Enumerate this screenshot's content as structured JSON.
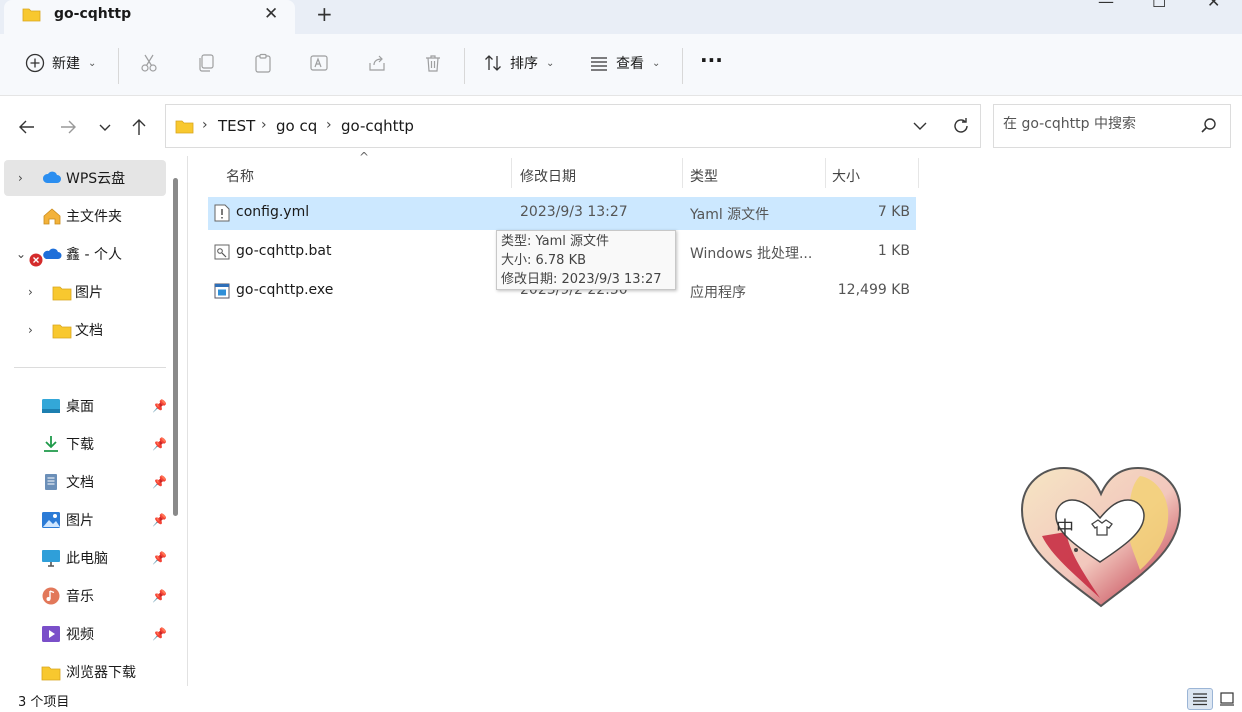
{
  "window": {
    "tab_title": "go-cqhttp",
    "tab_close": "✕",
    "new_tab": "+",
    "minimize": "—",
    "maximize": "☐",
    "close": "✕"
  },
  "toolbar": {
    "new_label": "新建",
    "sort_label": "排序",
    "view_label": "查看",
    "more_label": "···",
    "icons": [
      "add-circle-icon",
      "cut-icon",
      "copy-icon",
      "paste-icon",
      "rename-icon",
      "share-icon",
      "delete-icon",
      "sort-icon",
      "view-icon"
    ]
  },
  "address": {
    "crumbs": [
      "TEST",
      "go cq",
      "go-cqhttp"
    ],
    "separator": "›"
  },
  "search": {
    "placeholder": "在 go-cqhttp 中搜索"
  },
  "sidebar": {
    "items": [
      {
        "label": "WPS云盘",
        "icon": "cloud-icon"
      },
      {
        "label": "主文件夹",
        "icon": "home-icon"
      },
      {
        "label": "鑫 - 个人",
        "icon": "onedrive-icon"
      },
      {
        "label": "图片",
        "icon": "folder-icon"
      },
      {
        "label": "文档",
        "icon": "folder-icon"
      },
      {
        "label": "桌面",
        "icon": "desktop-icon"
      },
      {
        "label": "下载",
        "icon": "download-icon"
      },
      {
        "label": "文档",
        "icon": "document-icon"
      },
      {
        "label": "图片",
        "icon": "picture-icon"
      },
      {
        "label": "此电脑",
        "icon": "computer-icon"
      },
      {
        "label": "音乐",
        "icon": "music-icon"
      },
      {
        "label": "视频",
        "icon": "video-icon"
      },
      {
        "label": "浏览器下载",
        "icon": "folder-icon"
      }
    ]
  },
  "columns": {
    "name": "名称",
    "date": "修改日期",
    "type": "类型",
    "size": "大小"
  },
  "files": [
    {
      "name": "config.yml",
      "date": "2023/9/3 13:27",
      "type": "Yaml 源文件",
      "size": "7 KB",
      "icon": "yaml-file-icon"
    },
    {
      "name": "go-cqhttp.bat",
      "date": "",
      "type": "Windows 批处理...",
      "size": "1 KB",
      "icon": "batch-file-icon"
    },
    {
      "name": "go-cqhttp.exe",
      "date": "2023/9/2 22:50",
      "type": "应用程序",
      "size": "12,499 KB",
      "icon": "exe-file-icon"
    }
  ],
  "tooltip": {
    "line1": "类型: Yaml 源文件",
    "line2": "大小: 6.78 KB",
    "line3": "修改日期: 2023/9/3 13:27"
  },
  "sticker": {
    "char": "中"
  },
  "status": {
    "item_count": "3 个项目"
  },
  "colors": {
    "accent": "#0067c0",
    "selection": "#cce8ff",
    "folder": "#f8c82f"
  }
}
